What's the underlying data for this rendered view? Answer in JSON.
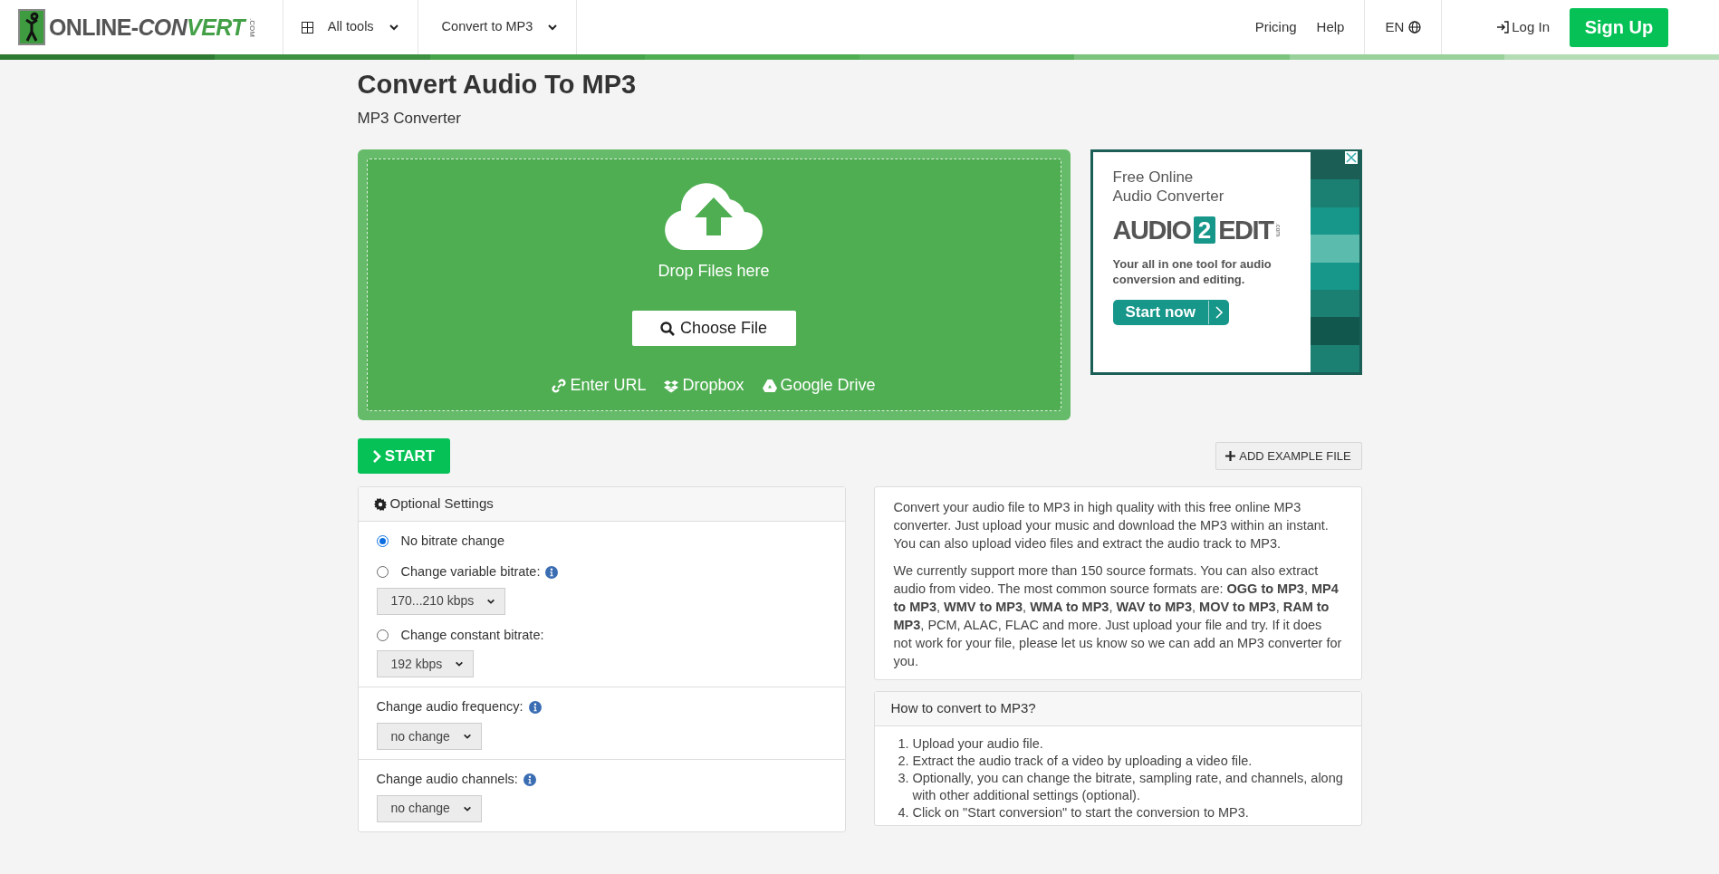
{
  "header": {
    "logo": {
      "parts": [
        {
          "text": "ONLINE-",
          "kind": "plain"
        },
        {
          "text": "CON",
          "kind": "slant"
        },
        {
          "text": "VERT",
          "kind": "accent"
        }
      ],
      "suffix": ".COM"
    },
    "nav": [
      {
        "label": "All tools",
        "kind": "grid"
      },
      {
        "label": "Convert to MP3",
        "kind": "plain"
      }
    ],
    "links": [
      "Pricing",
      "Help"
    ],
    "language": "EN",
    "login": "Log In",
    "signup": "Sign Up"
  },
  "page": {
    "title": "Convert Audio To MP3",
    "subtitle": "MP3 Converter"
  },
  "upload": {
    "drop_text": "Drop Files here",
    "choose_button": "Choose File",
    "sources": [
      {
        "label": "Enter URL",
        "kind": "link"
      },
      {
        "label": "Dropbox",
        "kind": "dropbox"
      },
      {
        "label": "Google Drive",
        "kind": "drive"
      }
    ]
  },
  "ad": {
    "headline": [
      "Free Online",
      "Audio Converter"
    ],
    "brand": {
      "left": "AUDIO",
      "badge": "2",
      "right": "EDIT",
      "domain": ".com"
    },
    "tagline": "Your all in one tool for audio conversion and editing.",
    "cta": "Start now"
  },
  "actions": {
    "start": "START",
    "add_example": "ADD EXAMPLE FILE"
  },
  "settings": {
    "title": "Optional Settings",
    "sections": [
      {
        "items": [
          {
            "kind": "radio",
            "label": "No bitrate change",
            "selected": true,
            "info": false
          },
          {
            "kind": "radio",
            "label": "Change variable bitrate:",
            "selected": false,
            "info": true,
            "select": "170...210 kbps"
          },
          {
            "kind": "radio",
            "label": "Change constant bitrate:",
            "selected": false,
            "info": false,
            "select": "192 kbps"
          }
        ]
      },
      {
        "items": [
          {
            "kind": "select",
            "label": "Change audio frequency:",
            "info": true,
            "select": "no change"
          }
        ]
      },
      {
        "items": [
          {
            "kind": "select",
            "label": "Change audio channels:",
            "info": true,
            "select": "no change"
          }
        ]
      }
    ]
  },
  "description": [
    "Convert your audio file to MP3 in high quality with this free online MP3 converter. Just upload your music and download the MP3 within an instant. You can also upload video files and extract the audio track to MP3.",
    "We currently support more than 150 source formats. You can also extract audio from video. The most common source formats are: **OGG to MP3**, **MP4 to MP3**, **WMV to MP3**, **WMA to MP3**, **WAV to MP3**, **MOV to MP3**, **RAM to MP3**, PCM, ALAC, FLAC and more. Just upload your file and try. If it does not work for your file, please let us know so we can add an MP3 converter for you."
  ],
  "howto": {
    "title": "How to convert to MP3?",
    "steps": [
      {
        "number": "1.",
        "text": "Upload your audio file."
      },
      {
        "number": "2.",
        "text": "Extract the audio track of a video by uploading a video file."
      },
      {
        "number": "3.",
        "text": "Optionally, you can change the bitrate, sampling rate, and channels, along with other additional settings (optional)."
      },
      {
        "number": "4.",
        "text": "Click on \"Start conversion\" to start the conversion to MP3."
      }
    ]
  }
}
